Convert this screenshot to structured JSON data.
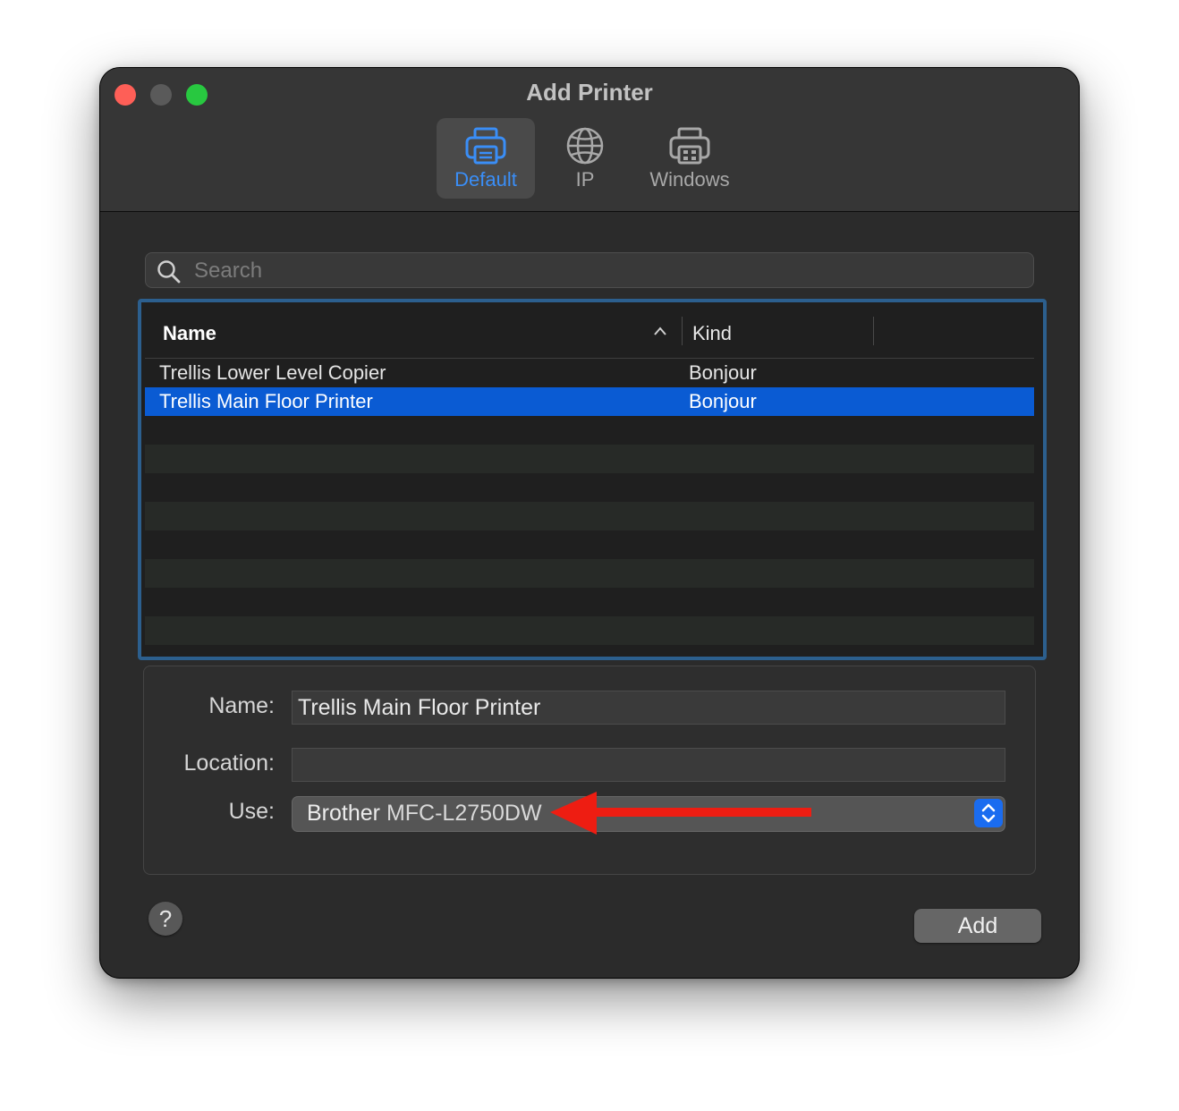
{
  "window": {
    "title": "Add Printer"
  },
  "toolbar": {
    "tabs": [
      {
        "label": "Default",
        "icon": "printer-icon",
        "selected": true
      },
      {
        "label": "IP",
        "icon": "globe-icon",
        "selected": false
      },
      {
        "label": "Windows",
        "icon": "windows-printer-icon",
        "selected": false
      }
    ]
  },
  "search": {
    "placeholder": "Search",
    "value": ""
  },
  "printer_list": {
    "columns": [
      "Name",
      "Kind"
    ],
    "sort": {
      "column": "Name",
      "direction": "ascending"
    },
    "rows": [
      {
        "name": "Trellis Lower Level Copier",
        "kind": "Bonjour",
        "selected": false
      },
      {
        "name": "Trellis Main Floor Printer",
        "kind": "Bonjour",
        "selected": true
      }
    ]
  },
  "details": {
    "name_label": "Name:",
    "name_value": "Trellis Main Floor Printer",
    "location_label": "Location:",
    "location_value": "",
    "use_label": "Use:",
    "use_brand": "Brother",
    "use_model": "MFC-L2750DW"
  },
  "buttons": {
    "help": "?",
    "add": "Add"
  },
  "colors": {
    "accent": "#0a5bd3",
    "selected_tab_text": "#3a8ef7",
    "annotation_arrow": "#ee1d12"
  }
}
